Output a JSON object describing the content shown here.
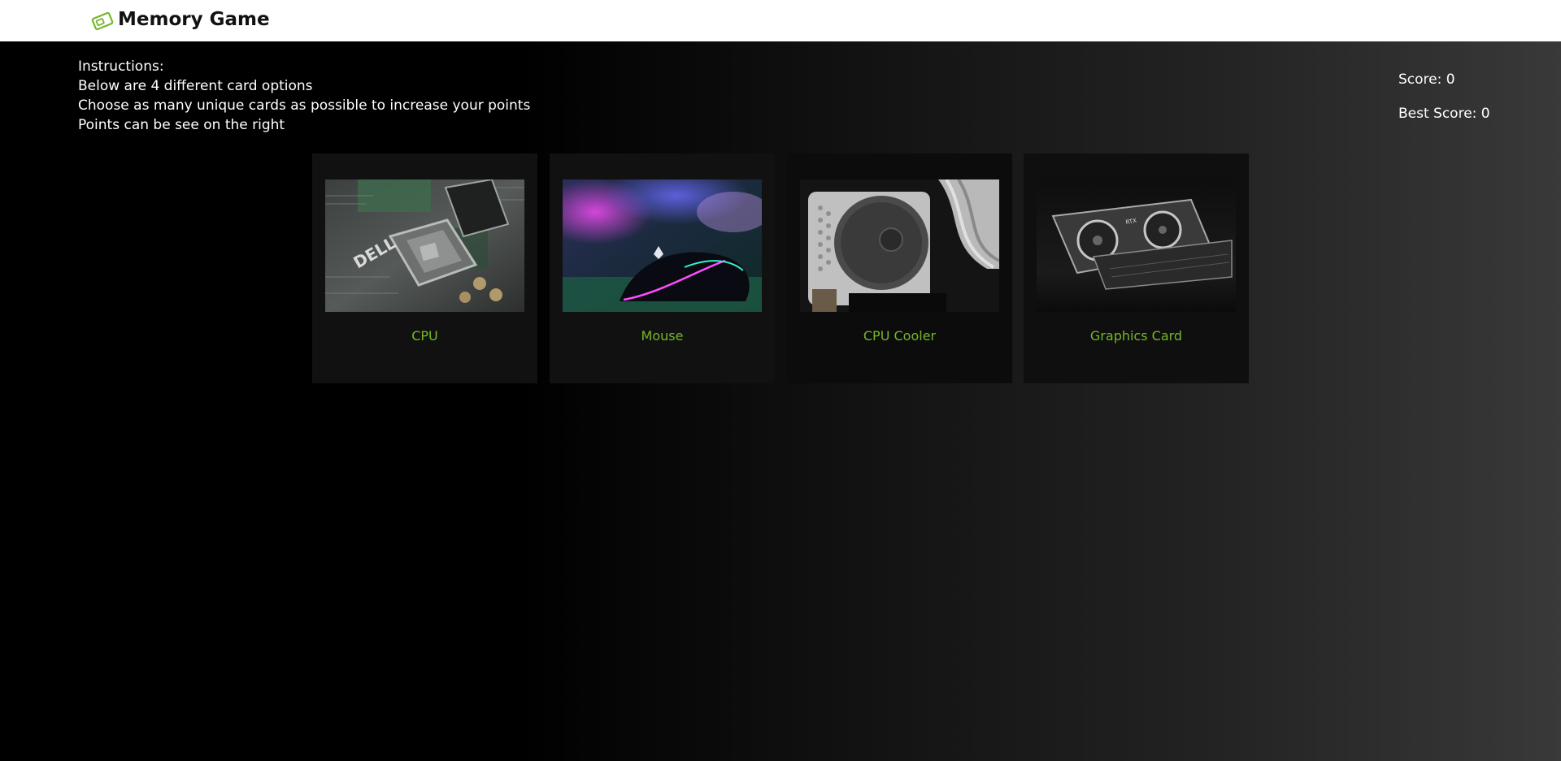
{
  "header": {
    "title": "Memory Game",
    "logo_icon": "cards-icon",
    "accent_color": "#76b72a"
  },
  "instructions": {
    "heading": "Instructions:",
    "lines": [
      "Below are 4 different card options",
      "Choose as many unique cards as possible to increase your points",
      "Points can be see on the right"
    ]
  },
  "scoreboard": {
    "score_label": "Score: 0",
    "best_label": "Best Score: 0"
  },
  "cards": [
    {
      "label": "CPU",
      "image": "cpu-socket-photo"
    },
    {
      "label": "Mouse",
      "image": "gaming-mouse-photo"
    },
    {
      "label": "CPU Cooler",
      "image": "cpu-cooler-photo"
    },
    {
      "label": "Graphics Card",
      "image": "graphics-card-photo"
    }
  ]
}
